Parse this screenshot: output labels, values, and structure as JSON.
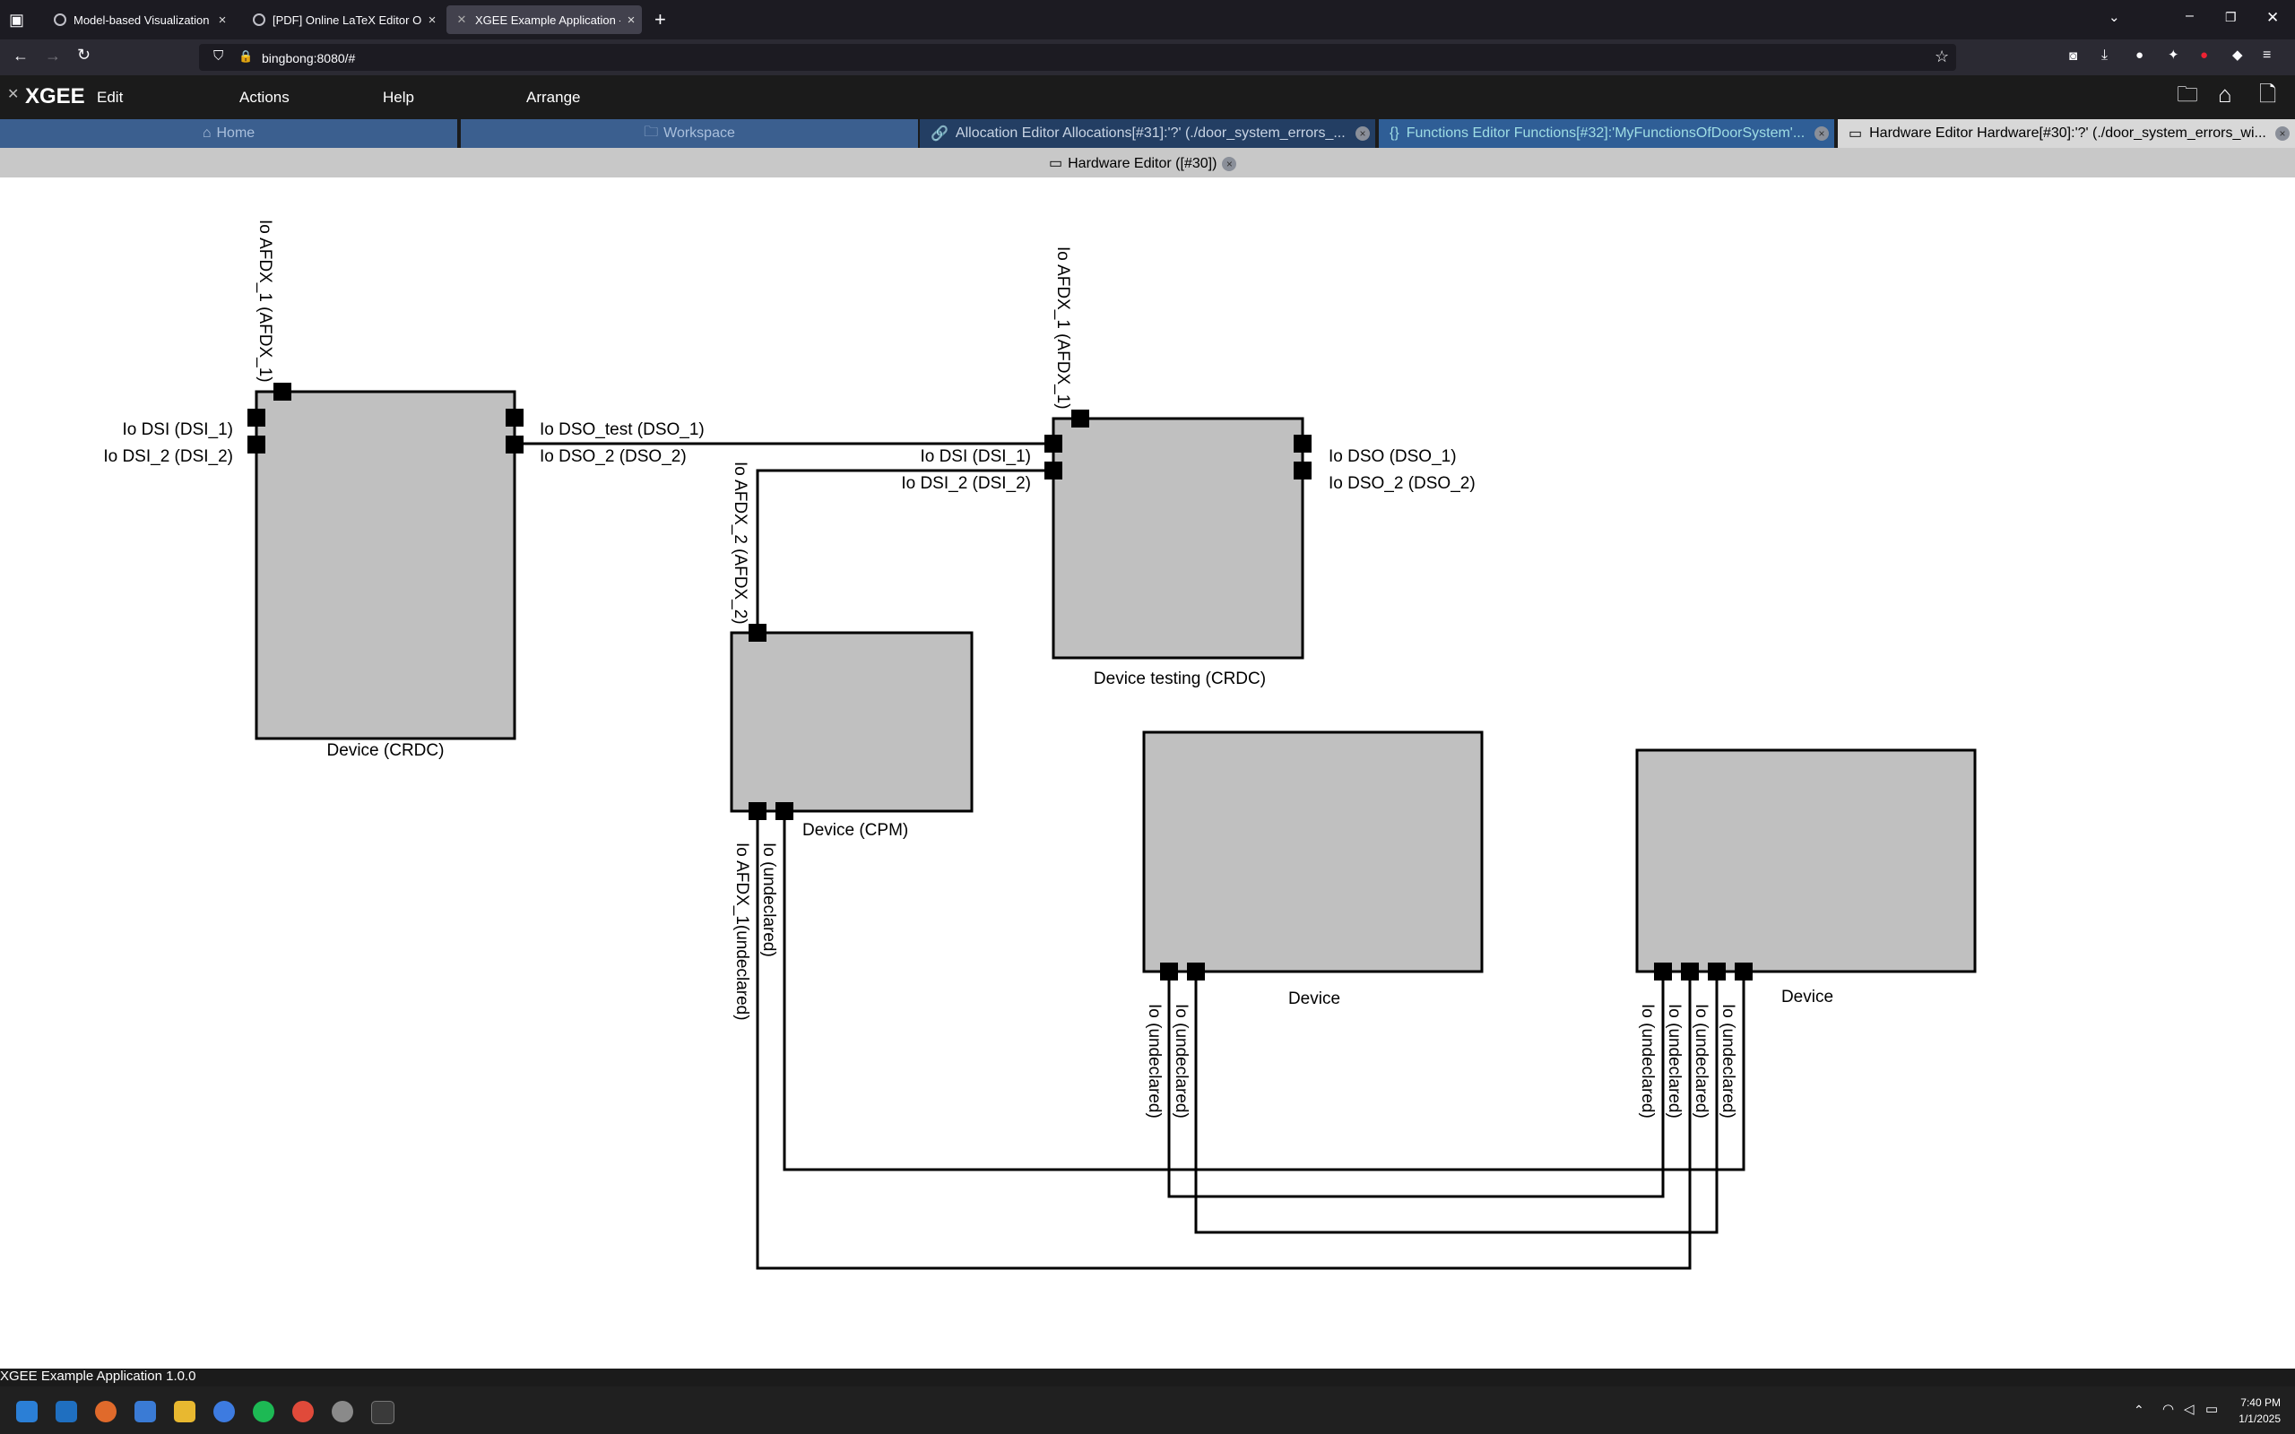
{
  "browser": {
    "tabs": [
      {
        "title": "Model-based Visualization Verif"
      },
      {
        "title": "[PDF] Online LaTeX Editor Over"
      },
      {
        "title": "XGEE Example Application - Ha"
      }
    ],
    "new_tab": "+",
    "url": "bingbong:8080/#"
  },
  "app": {
    "logo": "XGEE",
    "menus": [
      "Edit",
      "Actions",
      "Help",
      "Arrange"
    ],
    "tabs": [
      {
        "label": "Home"
      },
      {
        "label": "Workspace"
      },
      {
        "label": "Allocation Editor Allocations[#31]:'?' (./door_system_errors_..."
      },
      {
        "label": "Functions Editor Functions[#32]:'MyFunctionsOfDoorSystem'..."
      },
      {
        "label": "Hardware Editor Hardware[#30]:'?' (./door_system_errors_wi..."
      }
    ],
    "editor_title": "Hardware Editor ([#30])",
    "status": "XGEE Example Application 1.0.0"
  },
  "diagram": {
    "devices": [
      {
        "name": "Device (CRDC)",
        "ports": [
          "Io AFDX_1 (AFDX_1)",
          "Io DSI (DSI_1)",
          "Io DSI_2 (DSI_2)",
          "Io DSO_test (DSO_1)",
          "Io DSO_2 (DSO_2)"
        ]
      },
      {
        "name": "Device testing (CRDC)",
        "ports": [
          "Io AFDX_1 (AFDX_1)",
          "Io DSI (DSI_1)",
          "Io DSI_2 (DSI_2)",
          "Io DSO (DSO_1)",
          "Io DSO_2 (DSO_2)"
        ]
      },
      {
        "name": "Device (CPM)",
        "ports": [
          "Io AFDX_2 (AFDX_2)",
          "Io AFDX_1(undeclared)",
          "Io (undeclared)"
        ]
      },
      {
        "name": "Device",
        "ports": [
          "Io (undeclared)",
          "Io (undeclared)"
        ]
      },
      {
        "name": "Device",
        "ports": [
          "Io (undeclared)",
          "Io (undeclared)",
          "Io (undeclared)",
          "Io (undeclared)"
        ]
      }
    ]
  },
  "system": {
    "time": "7:40 PM",
    "date": "1/1/2025"
  },
  "colors": {
    "device_fill": "#c0c0c0",
    "app_bg": "#1b1b1b",
    "tab_blue": "#2d5b8f",
    "tab_active": "#d8d8d8"
  }
}
